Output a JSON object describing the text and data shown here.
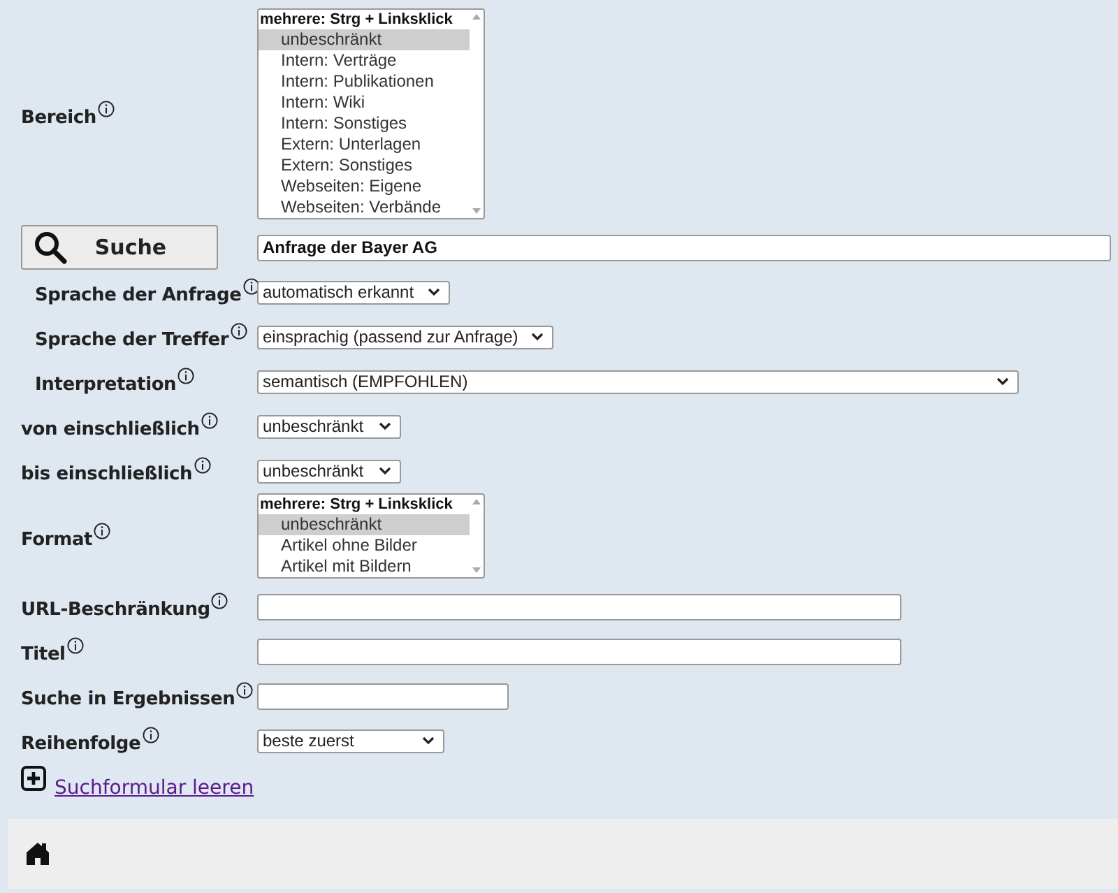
{
  "form": {
    "rows": [
      {
        "kind": "listbox",
        "label": "Bereich",
        "header": "mehrere: Strg + Linksklick",
        "options": [
          {
            "text": "unbeschränkt",
            "selected": true
          },
          {
            "text": "Intern: Verträge",
            "selected": false
          },
          {
            "text": "Intern: Publikationen",
            "selected": false
          },
          {
            "text": "Intern: Wiki",
            "selected": false
          },
          {
            "text": "Intern: Sonstiges",
            "selected": false
          },
          {
            "text": "Extern: Unterlagen",
            "selected": false
          },
          {
            "text": "Extern: Sonstiges",
            "selected": false
          },
          {
            "text": "Webseiten: Eigene",
            "selected": false
          },
          {
            "text": "Webseiten: Verbände",
            "selected": false
          }
        ]
      },
      {
        "kind": "search",
        "button": "Suche",
        "value": "Anfrage der Bayer AG",
        "children": [
          {
            "kind": "select",
            "label": "Sprache der Anfrage",
            "value": "automatisch erkannt"
          },
          {
            "kind": "select",
            "label": "Sprache der Treffer",
            "value": "einsprachig (passend zur Anfrage)"
          },
          {
            "kind": "select",
            "label": "Interpretation",
            "value": "semantisch (EMPFOHLEN)"
          }
        ]
      },
      {
        "kind": "select",
        "label": "von einschließlich",
        "value": "unbeschränkt"
      },
      {
        "kind": "select",
        "label": "bis einschließlich",
        "value": "unbeschränkt"
      },
      {
        "kind": "listbox",
        "label": "Format",
        "header": "mehrere: Strg + Linksklick",
        "options": [
          {
            "text": "unbeschränkt",
            "selected": true
          },
          {
            "text": "Artikel ohne Bilder",
            "selected": false
          },
          {
            "text": "Artikel mit Bildern",
            "selected": false
          }
        ]
      },
      {
        "kind": "text",
        "label": "URL-Beschränkung"
      },
      {
        "kind": "text",
        "label": "Titel"
      },
      {
        "kind": "text",
        "label": "Suche in Ergebnissen"
      },
      {
        "kind": "select",
        "label": "Reihenfolge",
        "value": "beste zuerst"
      }
    ],
    "reset_link": "Suchformular leeren"
  }
}
